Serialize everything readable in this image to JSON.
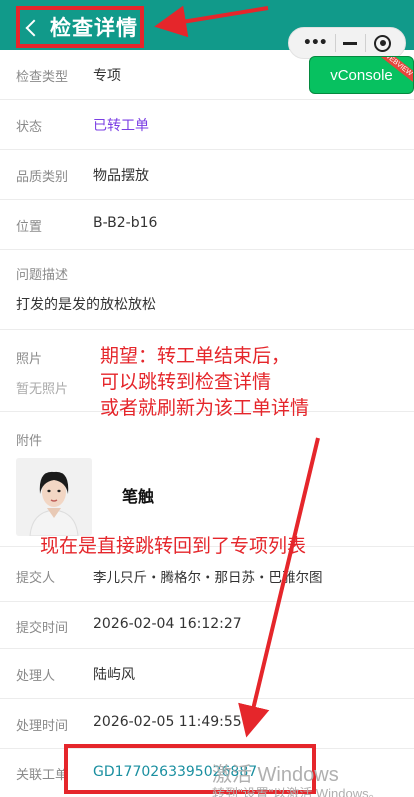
{
  "header": {
    "title": "检查详情",
    "bg_color": "#119a8a",
    "capsule": {
      "menu_glyph": "•••"
    }
  },
  "vconsole": {
    "label": "vConsole",
    "ribbon": "WEBVIEW"
  },
  "fields": {
    "inspection_type": {
      "label": "检查类型",
      "value": "专项"
    },
    "status": {
      "label": "状态",
      "value": "已转工单",
      "color": "#7b3fe4"
    },
    "quality_category": {
      "label": "品质类别",
      "value": "物品摆放"
    },
    "location": {
      "label": "位置",
      "value": "B-B2-b16"
    },
    "problem_desc": {
      "label": "问题描述",
      "value": "打发的是发的放松放松"
    },
    "photos": {
      "label": "照片",
      "value": "暂无照片"
    },
    "attachments": {
      "label": "附件",
      "logo_text": "笔触"
    },
    "submitter": {
      "label": "提交人",
      "value": "李儿只斤・腾格尔・那日苏・巴雅尔图"
    },
    "submit_time": {
      "label": "提交时间",
      "value": "2026-02-04 16:12:27"
    },
    "handler": {
      "label": "处理人",
      "value": "陆屿风"
    },
    "handle_time": {
      "label": "处理时间",
      "value": "2026-02-05 11:49:55"
    },
    "related_order": {
      "label": "关联工单",
      "value": "GD1770263395026887",
      "color": "#1a8fa0"
    }
  },
  "annotations": {
    "expectation": [
      "期望：转工单结束后，",
      "可以跳转到检查详情",
      "或者就刷新为该工单详情"
    ],
    "current": "现在是直接跳转回到了专项列表",
    "color": "#e5262b"
  },
  "watermark": {
    "line1": "激活 Windows",
    "line2": "转到\"设置\"以激活 Windows。"
  }
}
